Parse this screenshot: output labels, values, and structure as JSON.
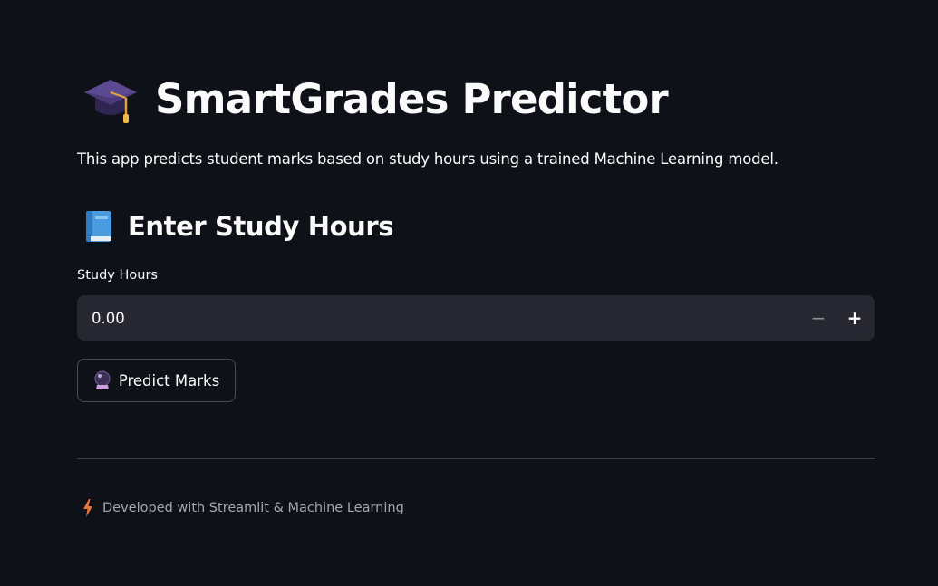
{
  "header": {
    "title_icon": "graduation-cap-icon",
    "title": "SmartGrades Predictor",
    "subtitle": "This app predicts student marks based on study hours using a trained Machine Learning model."
  },
  "section": {
    "icon": "blue-book-icon",
    "title": "Enter Study Hours"
  },
  "study_hours_input": {
    "label": "Study Hours",
    "value": "0.00",
    "decrement_symbol": "−",
    "increment_symbol": "+"
  },
  "predict_button": {
    "icon": "crystal-ball-icon",
    "label": "Predict Marks"
  },
  "footer": {
    "icon": "lightning-bolt-icon",
    "text": "Developed with Streamlit & Machine Learning"
  },
  "colors": {
    "background": "#0e1117",
    "input_background": "#262730",
    "text": "#fafafa",
    "muted_text": "#a3a8b4"
  }
}
